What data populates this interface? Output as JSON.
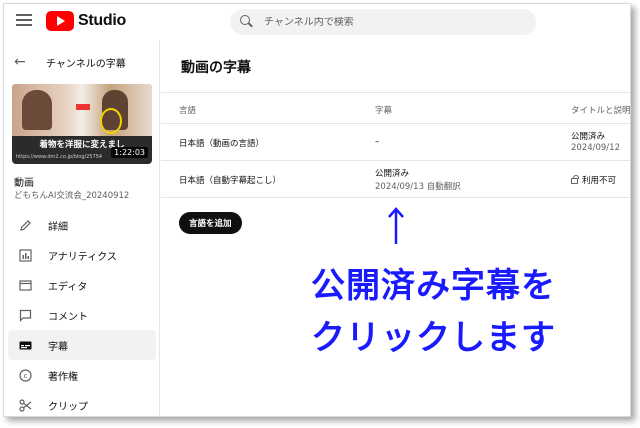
{
  "app": {
    "name": "Studio"
  },
  "search": {
    "placeholder": "チャンネル内で検索"
  },
  "sidebar": {
    "back_label": "チャンネルの字幕",
    "thumbnail": {
      "caption": "着物を洋服に変えまし",
      "url": "https://www.dm2.co.jp/blog/25754",
      "duration": "1:22:03"
    },
    "video_title": "動画",
    "video_name": "どもちんAI交流会_20240912",
    "nav": [
      {
        "label": "詳細",
        "icon": "pencil-icon"
      },
      {
        "label": "アナリティクス",
        "icon": "analytics-icon"
      },
      {
        "label": "エディタ",
        "icon": "editor-icon"
      },
      {
        "label": "コメント",
        "icon": "comment-icon"
      },
      {
        "label": "字幕",
        "icon": "subtitles-icon",
        "active": true
      },
      {
        "label": "著作権",
        "icon": "copyright-icon"
      },
      {
        "label": "クリップ",
        "icon": "clip-icon"
      }
    ]
  },
  "main": {
    "title": "動画の字幕",
    "columns": [
      "言語",
      "字幕",
      "タイトルと説明"
    ],
    "rows": [
      {
        "language": "日本語（動画の言語）",
        "subtitle_status": "–",
        "subtitle_date": "",
        "title_status": "公開済み",
        "title_date": "2024/09/12"
      },
      {
        "language": "日本語（自動字幕起こし）",
        "subtitle_status": "公開済み",
        "subtitle_date": "2024/09/13 自動翻訳",
        "title_status": "利用不可",
        "title_date": ""
      }
    ],
    "add_language_label": "言語を追加"
  },
  "annotation": {
    "line1": "公開済み字幕を",
    "line2": "クリックします",
    "color": "#1a1aff"
  }
}
